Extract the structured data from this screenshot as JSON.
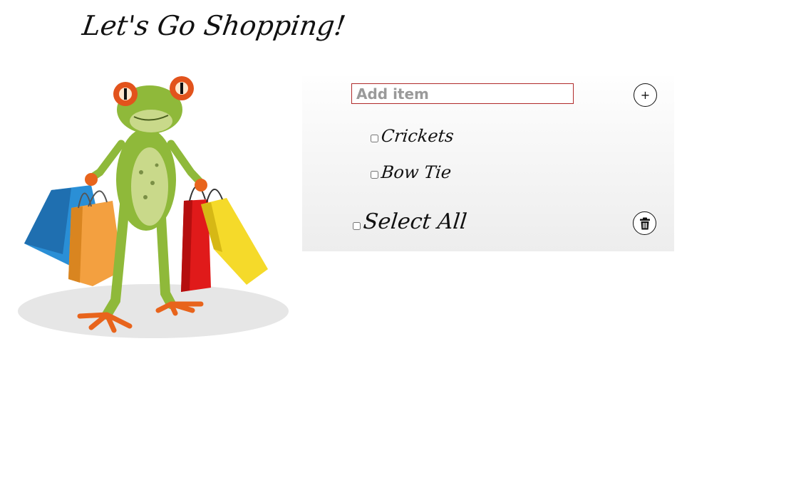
{
  "header": {
    "title": "Let's Go Shopping!"
  },
  "add_form": {
    "input_value": "",
    "input_placeholder": "Add item",
    "add_button_label": "+"
  },
  "items": [
    {
      "label": "Crickets",
      "checked": false
    },
    {
      "label": "Bow Tie",
      "checked": false
    }
  ],
  "footer": {
    "select_all_label": "Select All",
    "delete_icon": "trash-icon"
  },
  "illustration": {
    "icon": "frog-with-shopping-bags",
    "colors": {
      "frog": "#8fb93a",
      "eyes": "#e2531c",
      "bag_blue": "#2a8fd6",
      "bag_orange": "#f3a040",
      "bag_red": "#e01a1a",
      "bag_yellow": "#f5da2a"
    }
  },
  "colors": {
    "input_border": "#b02a2a",
    "panel_top": "#fefefe",
    "panel_bottom": "#ededed"
  }
}
